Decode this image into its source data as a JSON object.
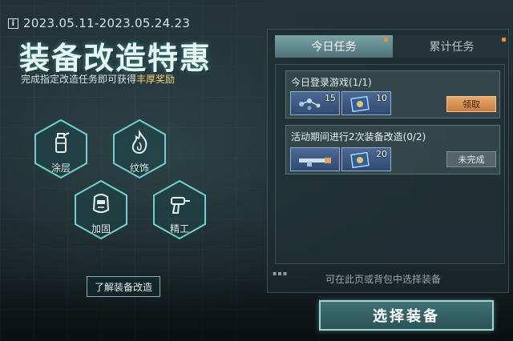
{
  "event": {
    "date_range": "2023.05.11-2023.05.24.23",
    "title": "装备改造特惠",
    "subtitle_prefix": "完成指定改造任务即可获得",
    "subtitle_highlight": "丰厚奖励"
  },
  "modules": [
    {
      "label": "涂层",
      "icon": "spray-can-icon"
    },
    {
      "label": "纹饰",
      "icon": "flame-icon"
    },
    {
      "label": "加固",
      "icon": "welding-mask-icon"
    },
    {
      "label": "精工",
      "icon": "drill-icon"
    }
  ],
  "learn_button": "了解装备改造",
  "tabs": [
    {
      "label": "今日任务",
      "active": true
    },
    {
      "label": "累计任务",
      "active": false
    }
  ],
  "tasks": [
    {
      "title": "今日登录游戏",
      "progress": "(1/1)",
      "rewards": [
        {
          "icon": "parts-icon",
          "count": "15"
        },
        {
          "icon": "blueprint-card-icon",
          "count": "10"
        }
      ],
      "action": "领取",
      "action_state": "claimable"
    },
    {
      "title": "活动期间进行2次装备改造",
      "progress": "(0/2)",
      "rewards": [
        {
          "icon": "weapon-part-icon",
          "count": ""
        },
        {
          "icon": "blueprint-card-icon",
          "count": "20"
        }
      ],
      "action": "未完成",
      "action_state": "incomplete"
    }
  ],
  "hint": "可在此页或背包中选择装备",
  "select_button": "选择装备",
  "colors": {
    "accent_teal": "#9fd4d3",
    "claim_orange": "#e9a96b",
    "highlight_yellow": "#f6d873",
    "item_blue": "#314a70"
  }
}
